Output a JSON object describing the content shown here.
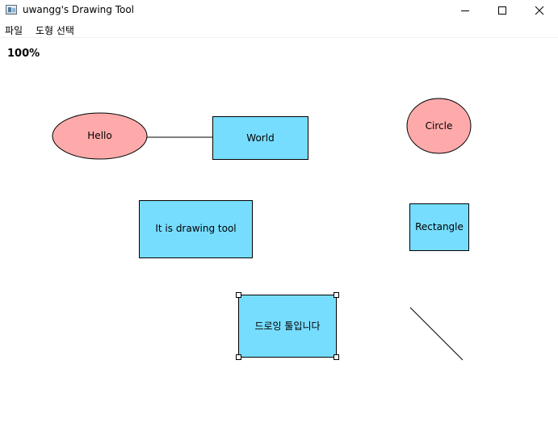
{
  "window": {
    "title": "uwangg's Drawing Tool",
    "icon": "app-window-icon",
    "controls": [
      "minimize-icon",
      "maximize-icon",
      "close-icon"
    ]
  },
  "menu": {
    "items": [
      "파일",
      "도형 선택"
    ]
  },
  "canvas": {
    "zoom": "100%",
    "shapes": [
      {
        "type": "ellipse",
        "label": "Hello",
        "fill": "#ffaaaa"
      },
      {
        "type": "rectangle",
        "label": "World",
        "fill": "#77ddff"
      },
      {
        "type": "connector",
        "from": "Hello",
        "to": "World"
      },
      {
        "type": "ellipse",
        "label": "Circle",
        "fill": "#ffaaaa"
      },
      {
        "type": "rectangle",
        "label": "It is drawing tool",
        "fill": "#77ddff"
      },
      {
        "type": "rectangle",
        "label": "Rectangle",
        "fill": "#77ddff"
      },
      {
        "type": "rectangle",
        "label": "드로잉 툴입니다",
        "fill": "#77ddff",
        "selected": true
      },
      {
        "type": "line"
      }
    ]
  },
  "colors": {
    "ellipse_fill": "#ffaaaa",
    "rect_fill": "#77ddff",
    "stroke": "#000000"
  }
}
